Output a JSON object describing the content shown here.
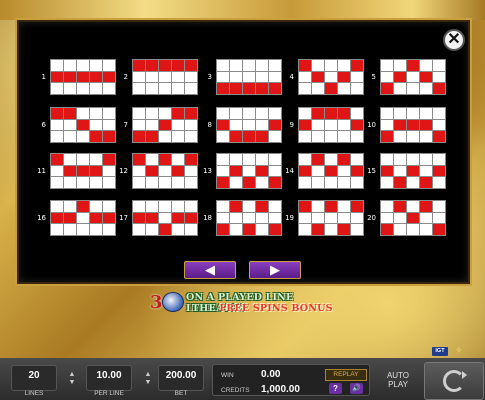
{
  "paylines_screen": {
    "close_icon": "✕",
    "lines": [
      {
        "number": "1",
        "pattern": [
          [
            0,
            0,
            0,
            0,
            0
          ],
          [
            1,
            1,
            1,
            1,
            1
          ],
          [
            0,
            0,
            0,
            0,
            0
          ]
        ]
      },
      {
        "number": "2",
        "pattern": [
          [
            1,
            1,
            1,
            1,
            1
          ],
          [
            0,
            0,
            0,
            0,
            0
          ],
          [
            0,
            0,
            0,
            0,
            0
          ]
        ]
      },
      {
        "number": "3",
        "pattern": [
          [
            0,
            0,
            0,
            0,
            0
          ],
          [
            0,
            0,
            0,
            0,
            0
          ],
          [
            1,
            1,
            1,
            1,
            1
          ]
        ]
      },
      {
        "number": "4",
        "pattern": [
          [
            1,
            0,
            0,
            0,
            1
          ],
          [
            0,
            1,
            0,
            1,
            0
          ],
          [
            0,
            0,
            1,
            0,
            0
          ]
        ]
      },
      {
        "number": "5",
        "pattern": [
          [
            0,
            0,
            1,
            0,
            0
          ],
          [
            0,
            1,
            0,
            1,
            0
          ],
          [
            1,
            0,
            0,
            0,
            1
          ]
        ]
      },
      {
        "number": "6",
        "pattern": [
          [
            1,
            1,
            0,
            0,
            0
          ],
          [
            0,
            0,
            1,
            0,
            0
          ],
          [
            0,
            0,
            0,
            1,
            1
          ]
        ]
      },
      {
        "number": "7",
        "pattern": [
          [
            0,
            0,
            0,
            1,
            1
          ],
          [
            0,
            0,
            1,
            0,
            0
          ],
          [
            1,
            1,
            0,
            0,
            0
          ]
        ]
      },
      {
        "number": "8",
        "pattern": [
          [
            0,
            0,
            0,
            0,
            0
          ],
          [
            1,
            0,
            0,
            0,
            1
          ],
          [
            0,
            1,
            1,
            1,
            0
          ]
        ]
      },
      {
        "number": "9",
        "pattern": [
          [
            0,
            1,
            1,
            1,
            0
          ],
          [
            1,
            0,
            0,
            0,
            1
          ],
          [
            0,
            0,
            0,
            0,
            0
          ]
        ]
      },
      {
        "number": "10",
        "pattern": [
          [
            0,
            0,
            0,
            0,
            0
          ],
          [
            0,
            1,
            1,
            1,
            0
          ],
          [
            1,
            0,
            0,
            0,
            1
          ]
        ]
      },
      {
        "number": "11",
        "pattern": [
          [
            1,
            0,
            0,
            0,
            1
          ],
          [
            0,
            1,
            1,
            1,
            0
          ],
          [
            0,
            0,
            0,
            0,
            0
          ]
        ]
      },
      {
        "number": "12",
        "pattern": [
          [
            1,
            0,
            1,
            0,
            1
          ],
          [
            0,
            1,
            0,
            1,
            0
          ],
          [
            0,
            0,
            0,
            0,
            0
          ]
        ]
      },
      {
        "number": "13",
        "pattern": [
          [
            0,
            0,
            0,
            0,
            0
          ],
          [
            0,
            1,
            0,
            1,
            0
          ],
          [
            1,
            0,
            1,
            0,
            1
          ]
        ]
      },
      {
        "number": "14",
        "pattern": [
          [
            0,
            1,
            0,
            1,
            0
          ],
          [
            1,
            0,
            1,
            0,
            1
          ],
          [
            0,
            0,
            0,
            0,
            0
          ]
        ]
      },
      {
        "number": "15",
        "pattern": [
          [
            0,
            0,
            0,
            0,
            0
          ],
          [
            1,
            0,
            1,
            0,
            1
          ],
          [
            0,
            1,
            0,
            1,
            0
          ]
        ]
      },
      {
        "number": "16",
        "pattern": [
          [
            0,
            0,
            1,
            0,
            0
          ],
          [
            1,
            1,
            0,
            1,
            1
          ],
          [
            0,
            0,
            0,
            0,
            0
          ]
        ]
      },
      {
        "number": "17",
        "pattern": [
          [
            0,
            0,
            0,
            0,
            0
          ],
          [
            1,
            1,
            0,
            1,
            1
          ],
          [
            0,
            0,
            1,
            0,
            0
          ]
        ]
      },
      {
        "number": "18",
        "pattern": [
          [
            0,
            1,
            0,
            1,
            0
          ],
          [
            0,
            0,
            0,
            0,
            0
          ],
          [
            1,
            0,
            1,
            0,
            1
          ]
        ]
      },
      {
        "number": "19",
        "pattern": [
          [
            1,
            0,
            1,
            0,
            1
          ],
          [
            0,
            0,
            0,
            0,
            0
          ],
          [
            0,
            1,
            0,
            1,
            0
          ]
        ]
      },
      {
        "number": "20",
        "pattern": [
          [
            0,
            1,
            0,
            1,
            0
          ],
          [
            0,
            0,
            1,
            0,
            0
          ],
          [
            1,
            0,
            0,
            0,
            1
          ]
        ]
      }
    ],
    "prev_arrow": "◀",
    "next_arrow": "▶",
    "colors": {
      "active_cell": "#e01515",
      "inactive_cell": "#ffffff",
      "panel": "#000000"
    }
  },
  "bonus_banner": {
    "count": "3",
    "line1": "ON A PLAYED LINE INITIATES",
    "line2_prefix": "THE",
    "line2_highlight": "FREE SPINS BONUS",
    "icon": "bonus-symbol-icon"
  },
  "brand": {
    "logo": "IGT"
  },
  "controls": {
    "lines": {
      "value": "20",
      "label": "LINES"
    },
    "per_line": {
      "value": "10.00",
      "label": "PER LINE"
    },
    "bet": {
      "value": "200.00",
      "label": "BET"
    },
    "win": {
      "label": "WIN",
      "value": "0.00"
    },
    "credits": {
      "label": "CREDITS",
      "value": "1,000.00"
    },
    "replay_label": "REPLAY",
    "help_label": "?",
    "sound_icon": "🔊",
    "autoplay_line1": "AUTO",
    "autoplay_line2": "PLAY",
    "stepper_up": "▲",
    "stepper_down": "▼"
  }
}
